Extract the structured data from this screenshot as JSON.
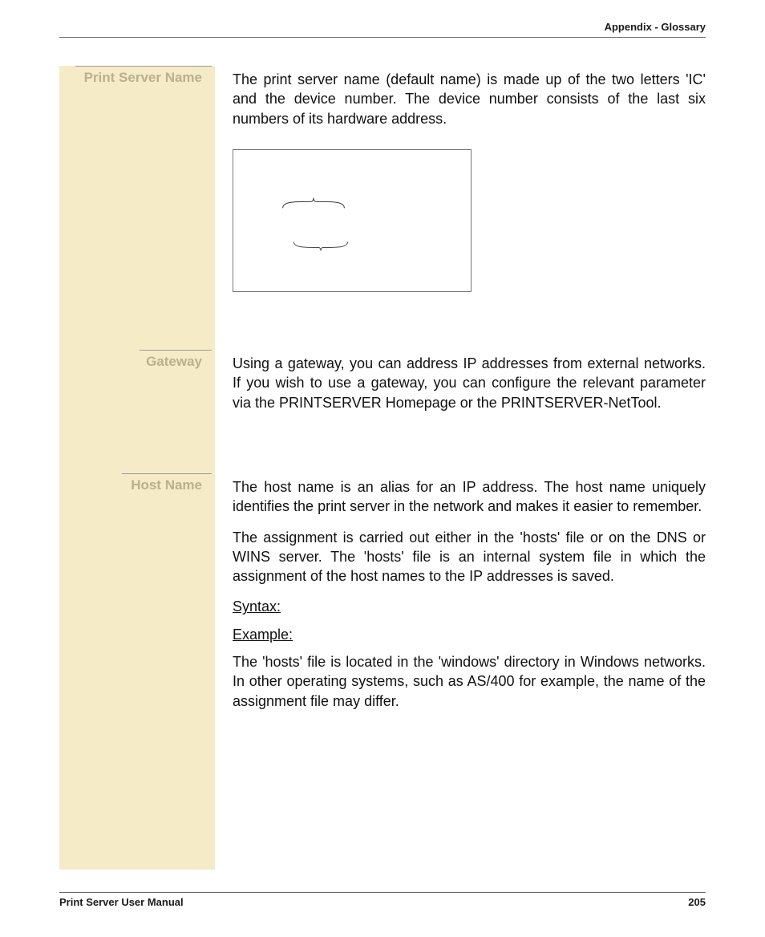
{
  "header": {
    "title": "Appendix - Glossary"
  },
  "sections": {
    "print_server_name": {
      "term": "Print Server Name",
      "p1": "The print server name (default name) is made up of the two letters 'IC' and the device number. The device number consists of the last six numbers of its hardware address."
    },
    "gateway": {
      "term": "Gateway",
      "p1": "Using a gateway, you can address IP addresses from external networks. If you wish to use a gateway, you can configure the relevant parameter via the PRINTSERVER Homepage or the PRINTSERVER-NetTool."
    },
    "host_name": {
      "term": "Host Name",
      "p1": "The host name is an alias for an IP address. The host name uniquely identifies the print server in the network and makes it easier to remember.",
      "p2": "The assignment is carried out either in the 'hosts' file or on the DNS or WINS server. The 'hosts' file is an internal system file in which the assignment of the host names to the IP addresses is saved.",
      "syntax": "Syntax:",
      "example": "Example:",
      "p3": "The 'hosts' file is located in the 'windows' directory in Windows networks. In other operating systems, such as AS/400 for example, the name of the assignment file may differ."
    }
  },
  "footer": {
    "manual": "Print Server User Manual",
    "page": "205"
  }
}
